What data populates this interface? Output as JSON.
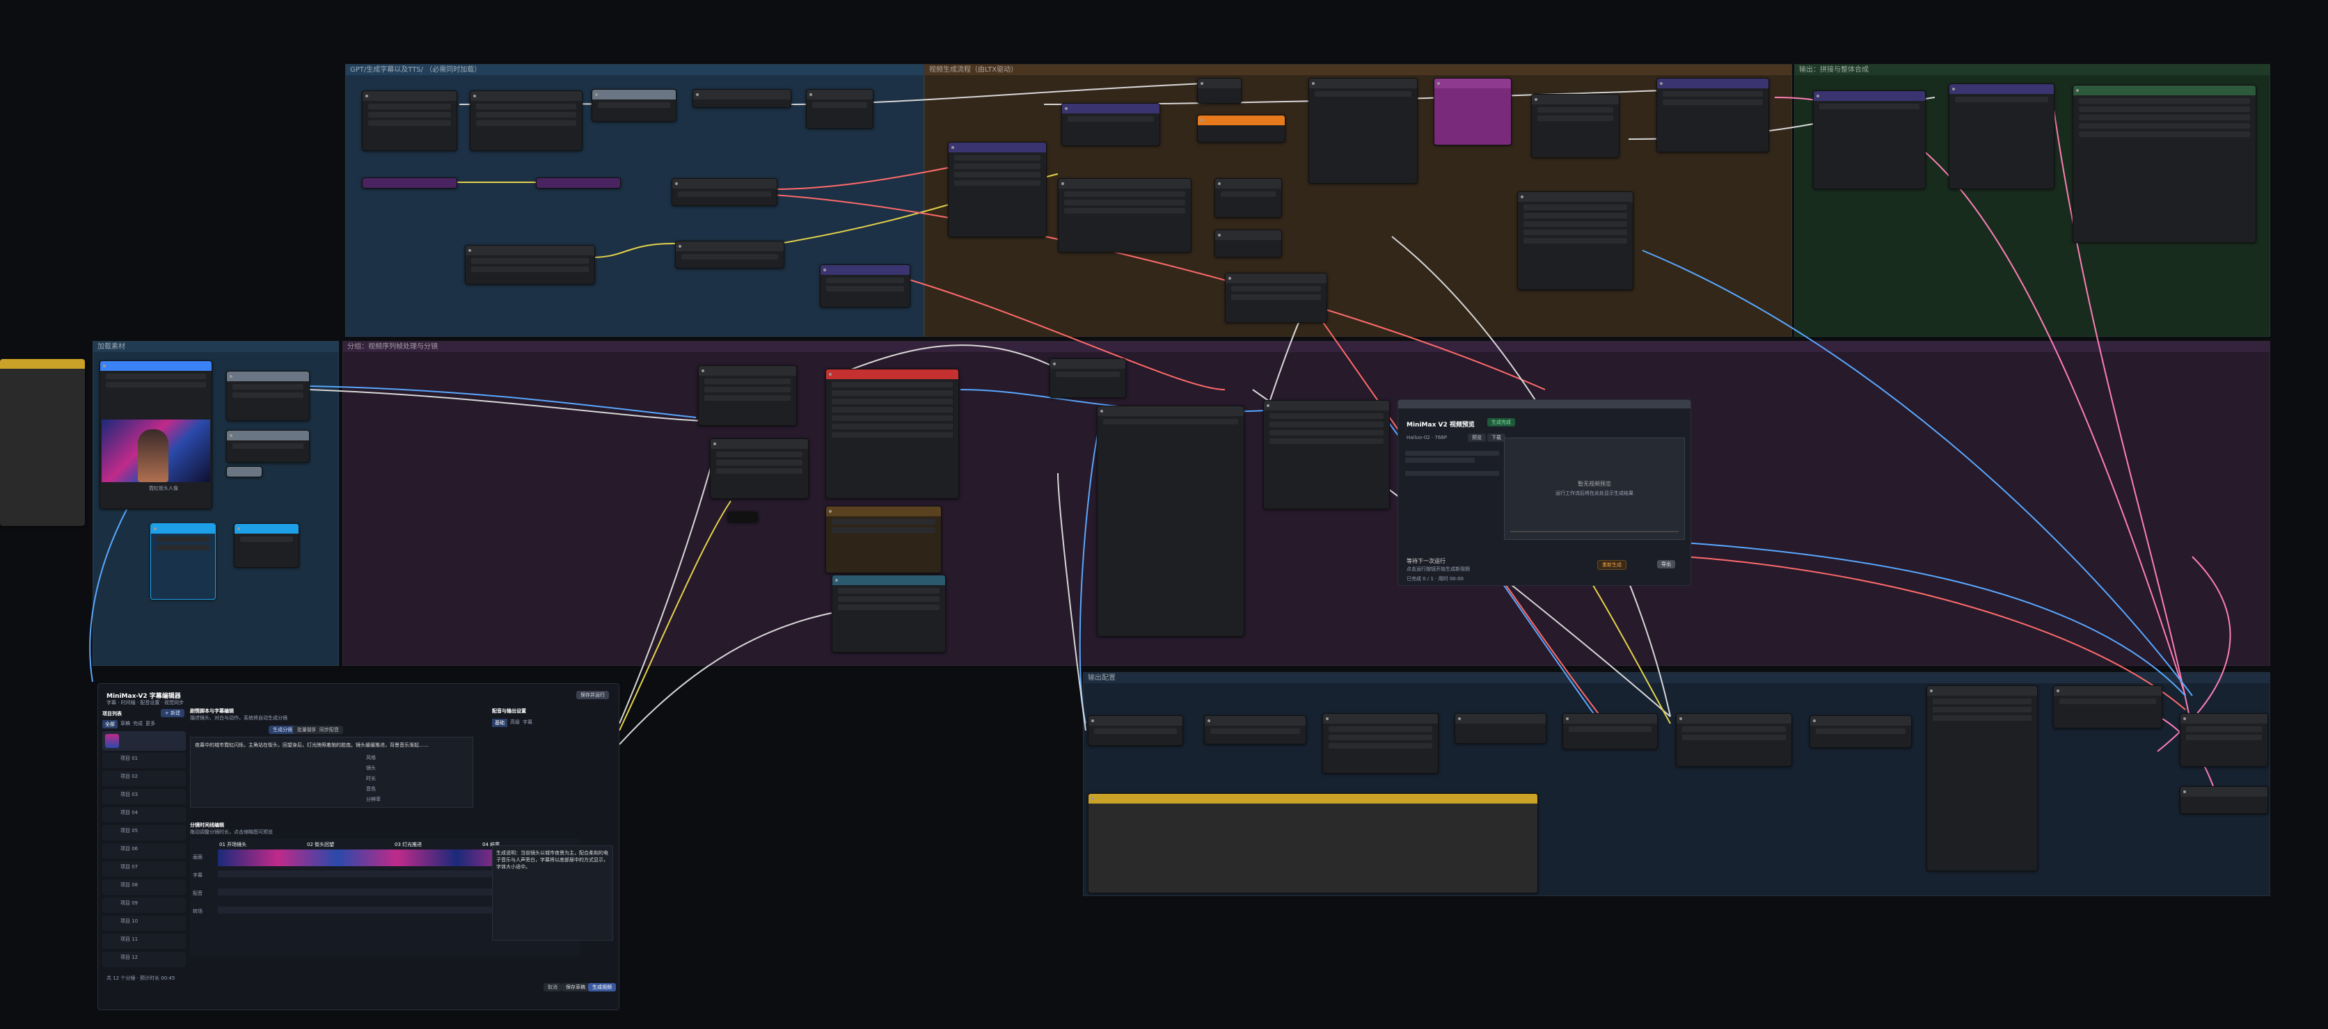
{
  "groups": {
    "g1": "GPT/生成字幕以及TTS/ （必需同时加载）",
    "g2": "视频生成流程（由LTX驱动）",
    "g3": "输出：拼接与整体合成",
    "g4": "加载素材",
    "g5": "分组：视频序列帧处理与分镜",
    "g6": "输出配置"
  },
  "colors": {
    "wire_blue": "#5aa8ff",
    "wire_pink": "#ff7eb6",
    "wire_yellow": "#e5d34a",
    "wire_white": "#d8d8d8",
    "wire_red": "#ff6b6b",
    "group_blue": "#1d3346",
    "group_brown": "#3a2a1a",
    "group_green": "#1a3322",
    "group_purple": "#2a1c30"
  },
  "editor": {
    "title": "MiniMax-V2 字幕编辑器",
    "subtitle": "字幕 · 时间轴 · 配音设置 · 视觉同步",
    "header_btn": "保存并运行",
    "project_label": "项目列表",
    "project_btn": "+ 新建",
    "tabs": [
      "全部",
      "草稿",
      "完成",
      "更多"
    ],
    "script_title": "剧情脚本与字幕编辑",
    "script_sub": "描述镜头、对白与动作，系统将自动生成分镜",
    "script_tags": [
      "生成分镜",
      "批量替换",
      "同步配音"
    ],
    "script_body": "夜幕中的城市霓虹闪烁，主角站在街头，回望身后，灯光映照着她的脸庞。镜头缓缓推进，背景音乐渐起……",
    "params": [
      "风格",
      "镜头",
      "时长",
      "音色",
      "分辨率"
    ],
    "timeline_title": "分镜时间线编辑",
    "timeline_sub": "拖动调整分镜时长，点击缩略图可预览",
    "timeline_rows": [
      "画面",
      "字幕",
      "配音",
      "转场"
    ],
    "clips": [
      "01 开场镜头",
      "02 街头回望",
      "03 灯光推进",
      "04 结尾"
    ],
    "right_title": "配音与输出设置",
    "right_tabs": [
      "基础",
      "高级",
      "字幕"
    ],
    "right_text": "生成说明：当前镜头以城市夜景为主，配合柔和的电子音乐与人声旁白，字幕将以底部居中的方式显示，字体大小适中。",
    "footer_hint": "共 12 个分镜 · 预计时长 00:45",
    "footer_btns": [
      "取消",
      "保存草稿",
      "生成视频"
    ],
    "projects": [
      "项目 01",
      "项目 02",
      "项目 03",
      "项目 04",
      "项目 05",
      "项目 06",
      "项目 07",
      "项目 08",
      "项目 09",
      "项目 10",
      "项目 11",
      "项目 12"
    ]
  },
  "player": {
    "title": "MiniMax V2 视频预览",
    "badge": "生成完成",
    "model_label": "Hailuo-02 · 768P",
    "tags": [
      "预览",
      "下载"
    ],
    "preview_title": "暂无视频预览",
    "preview_sub": "运行工作流后将在此处显示生成结果",
    "status_title": "等待下一次运行",
    "status_sub": "点击运行按钮开始生成新视频",
    "btns": [
      "重新生成",
      "导出"
    ],
    "footer": "已完成 0 / 1 · 用时 00:00"
  },
  "image_caption": "霓虹街头人像"
}
